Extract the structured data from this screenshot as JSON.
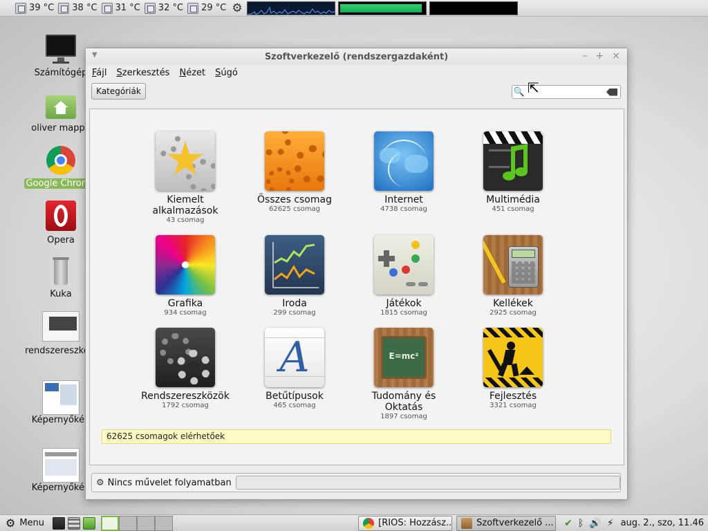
{
  "top_panel": {
    "temps": [
      "39 °C",
      "38 °C",
      "31 °C",
      "32 °C",
      "29 °C"
    ],
    "memory_used_fraction": 0.97
  },
  "desktop_icons": [
    {
      "label": "Számítógép",
      "selected": false
    },
    {
      "label": "oliver mappa",
      "selected": false
    },
    {
      "label": "Google Chrome",
      "selected": true
    },
    {
      "label": "Opera",
      "selected": false
    },
    {
      "label": "Kuka",
      "selected": false
    },
    {
      "label": "rendszereszközök",
      "selected": false
    },
    {
      "label": "Képernyőkép",
      "selected": false
    },
    {
      "label": "Képernyőkép",
      "selected": false
    }
  ],
  "window": {
    "title": "Szoftverkezelő (rendszergazdaként)",
    "menu": [
      {
        "key": "F",
        "rest": "ájl"
      },
      {
        "key": "S",
        "rest": "zerkesztés"
      },
      {
        "key": "N",
        "rest": "ézet"
      },
      {
        "key": "S",
        "rest": "úgó"
      }
    ],
    "categories_button": "Kategóriák",
    "search": {
      "value": "",
      "placeholder": ""
    },
    "categories": [
      {
        "name": "Kiemelt alkalmazások",
        "count": "43 csomag",
        "icon": "featured-star-icon"
      },
      {
        "name": "Összes csomag",
        "count": "62625 csomag",
        "icon": "all-packages-gears-icon"
      },
      {
        "name": "Internet",
        "count": "4738 csomag",
        "icon": "internet-globe-icon"
      },
      {
        "name": "Multimédia",
        "count": "451 csomag",
        "icon": "multimedia-clapper-icon"
      },
      {
        "name": "Grafika",
        "count": "934 csomag",
        "icon": "graphics-color-wheel-icon"
      },
      {
        "name": "Iroda",
        "count": "299 csomag",
        "icon": "office-chart-icon"
      },
      {
        "name": "Játékok",
        "count": "1815 csomag",
        "icon": "games-gamepad-icon"
      },
      {
        "name": "Kellékek",
        "count": "2925 csomag",
        "icon": "accessories-calculator-icon"
      },
      {
        "name": "Rendszereszközök",
        "count": "1792 csomag",
        "icon": "system-tools-gear-icon"
      },
      {
        "name": "Betűtípusok",
        "count": "465 csomag",
        "icon": "fonts-letter-a-icon"
      },
      {
        "name": "Tudomány és Oktatás",
        "count": "1897 csomag",
        "icon": "science-chalkboard-icon"
      },
      {
        "name": "Fejlesztés",
        "count": "3321 csomag",
        "icon": "development-worker-sign-icon"
      }
    ],
    "available_message": "62625 csomagok elérhetőek",
    "status_text": "Nincs művelet folyamatban"
  },
  "bottom_panel": {
    "menu_label": "Menu",
    "tasks": [
      "[RIOS: Hozzász...",
      "Szoftverkezelő ..."
    ],
    "clock": "aug.  2., szo, 11.46"
  }
}
